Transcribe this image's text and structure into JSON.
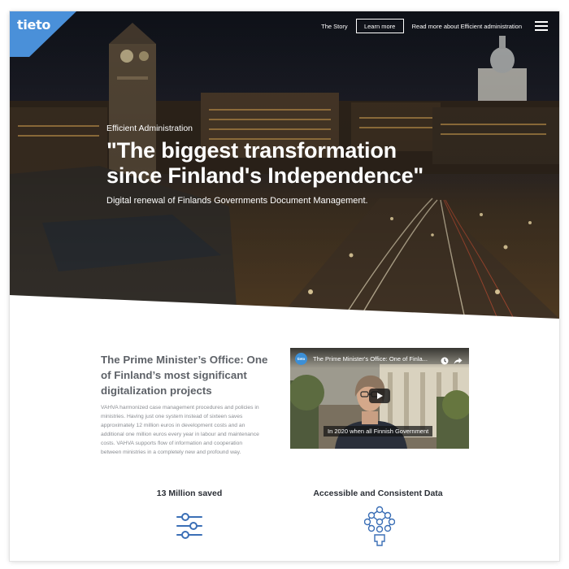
{
  "brand": {
    "logo_text": "tieto"
  },
  "nav": {
    "story_label": "The Story",
    "learn_more_label": "Learn more",
    "efficient_admin_label": "Read more about Efficient administration"
  },
  "hero": {
    "eyebrow": "Efficient Administration",
    "headline_line1": "\"The biggest transformation",
    "headline_line2": "since Finland's Independence\"",
    "subline": "Digital renewal of Finlands Governments Document Management."
  },
  "intro": {
    "title_line1": "The Prime Minister’s Office: One",
    "title_line2": "of Finland’s most significant",
    "title_line3": "digitalization projects",
    "body_lines": [
      "VAHVA harmonized case management procedures and policies in",
      "ministries. Having just one system instead of sixteen saves",
      "approximately 12 million euros in development costs and an",
      "additional one million euros every year in labour and maintenance",
      "costs. VAHVA supports flow of information and cooperation",
      "between ministries in a completely new and profound way."
    ]
  },
  "video": {
    "channel_logo": "tieto",
    "title": "The Prime Minister's Office: One of Finla...",
    "caption": "In 2020 when all Finnish Government"
  },
  "stats": [
    {
      "label": "13 Million saved",
      "icon": "sliders-icon"
    },
    {
      "label": "Accessible and Consistent Data",
      "icon": "people-network-icon"
    }
  ],
  "colors": {
    "brand_blue": "#4a90d9",
    "icon_blue": "#3b6fb6",
    "heading_gray": "#5e6268",
    "body_gray": "#8a8d92"
  }
}
